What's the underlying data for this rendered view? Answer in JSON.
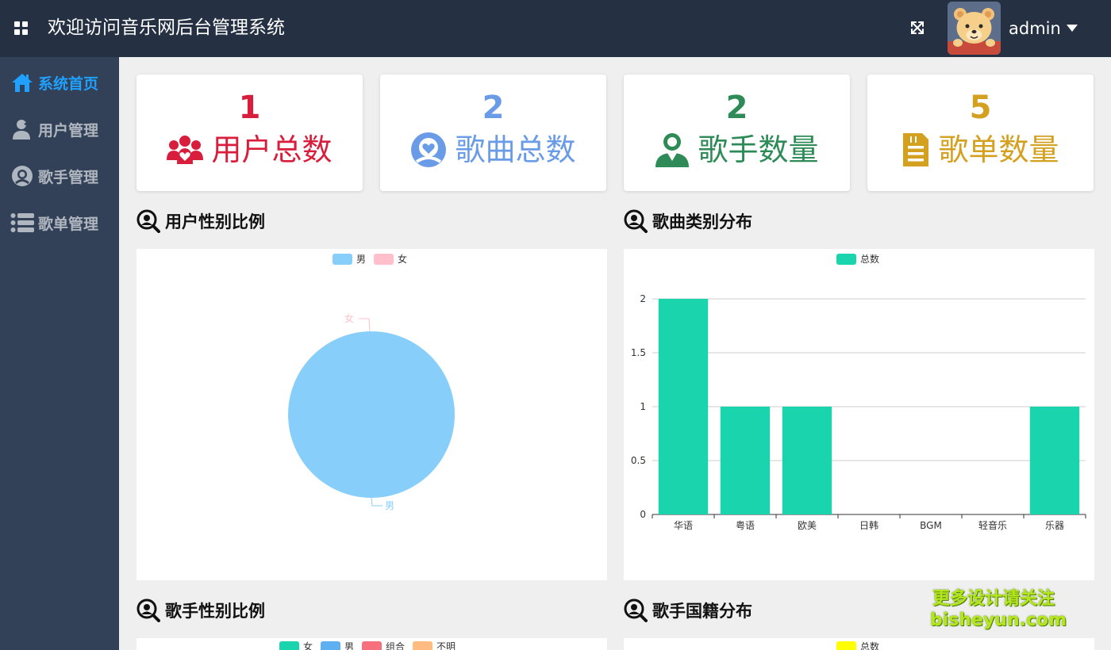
{
  "header": {
    "title": "欢迎访问音乐网后台管理系统",
    "username": "admin"
  },
  "sidebar": {
    "items": [
      {
        "label": "系统首页",
        "icon": "home-icon",
        "active": true
      },
      {
        "label": "用户管理",
        "icon": "user-add-icon",
        "active": false
      },
      {
        "label": "歌手管理",
        "icon": "singer-icon",
        "active": false
      },
      {
        "label": "歌单管理",
        "icon": "list-icon",
        "active": false
      }
    ]
  },
  "stats": [
    {
      "value": "1",
      "label": "用户总数",
      "icon": "users-group-icon",
      "color": "#d81e3c"
    },
    {
      "value": "2",
      "label": "歌曲总数",
      "icon": "song-heart-icon",
      "color": "#6a9be6"
    },
    {
      "value": "2",
      "label": "歌手数量",
      "icon": "singer-person-icon",
      "color": "#2e8b57"
    },
    {
      "value": "5",
      "label": "歌单数量",
      "icon": "playlist-doc-icon",
      "color": "#d4a020"
    }
  ],
  "sections": {
    "user_gender": "用户性别比例",
    "song_category": "歌曲类别分布",
    "singer_gender": "歌手性别比例",
    "singer_nationality": "歌手国籍分布"
  },
  "watermark": {
    "line1": "更多设计请关注",
    "line2": "bisheyun.com"
  },
  "chart_data": [
    {
      "type": "pie",
      "legend": [
        {
          "name": "男",
          "color": "#87cefa"
        },
        {
          "name": "女",
          "color": "#ffc0cb"
        }
      ],
      "slices": [
        {
          "name": "男",
          "value": 1,
          "color": "#87cefa"
        },
        {
          "name": "女",
          "value": 0,
          "color": "#ffc0cb"
        }
      ]
    },
    {
      "type": "bar",
      "legend": [
        {
          "name": "总数",
          "color": "#1ad4ae"
        }
      ],
      "categories": [
        "华语",
        "粤语",
        "欧美",
        "日韩",
        "BGM",
        "轻音乐",
        "乐器"
      ],
      "series": [
        {
          "name": "总数",
          "values": [
            2,
            1,
            1,
            0,
            0,
            0,
            1
          ],
          "color": "#1ad4ae"
        }
      ],
      "ylim": [
        0,
        2
      ],
      "yticks": [
        "0",
        "0.5",
        "1",
        "1.5",
        "2"
      ],
      "grid": true
    },
    {
      "type": "pie",
      "legend": [
        {
          "name": "女",
          "color": "#1ad4ae"
        },
        {
          "name": "男",
          "color": "#5fb0f0"
        },
        {
          "name": "组合",
          "color": "#f7707e"
        },
        {
          "name": "不明",
          "color": "#ffbb80"
        }
      ]
    },
    {
      "type": "bar",
      "legend": [
        {
          "name": "总数",
          "color": "#ffff00"
        }
      ]
    }
  ]
}
